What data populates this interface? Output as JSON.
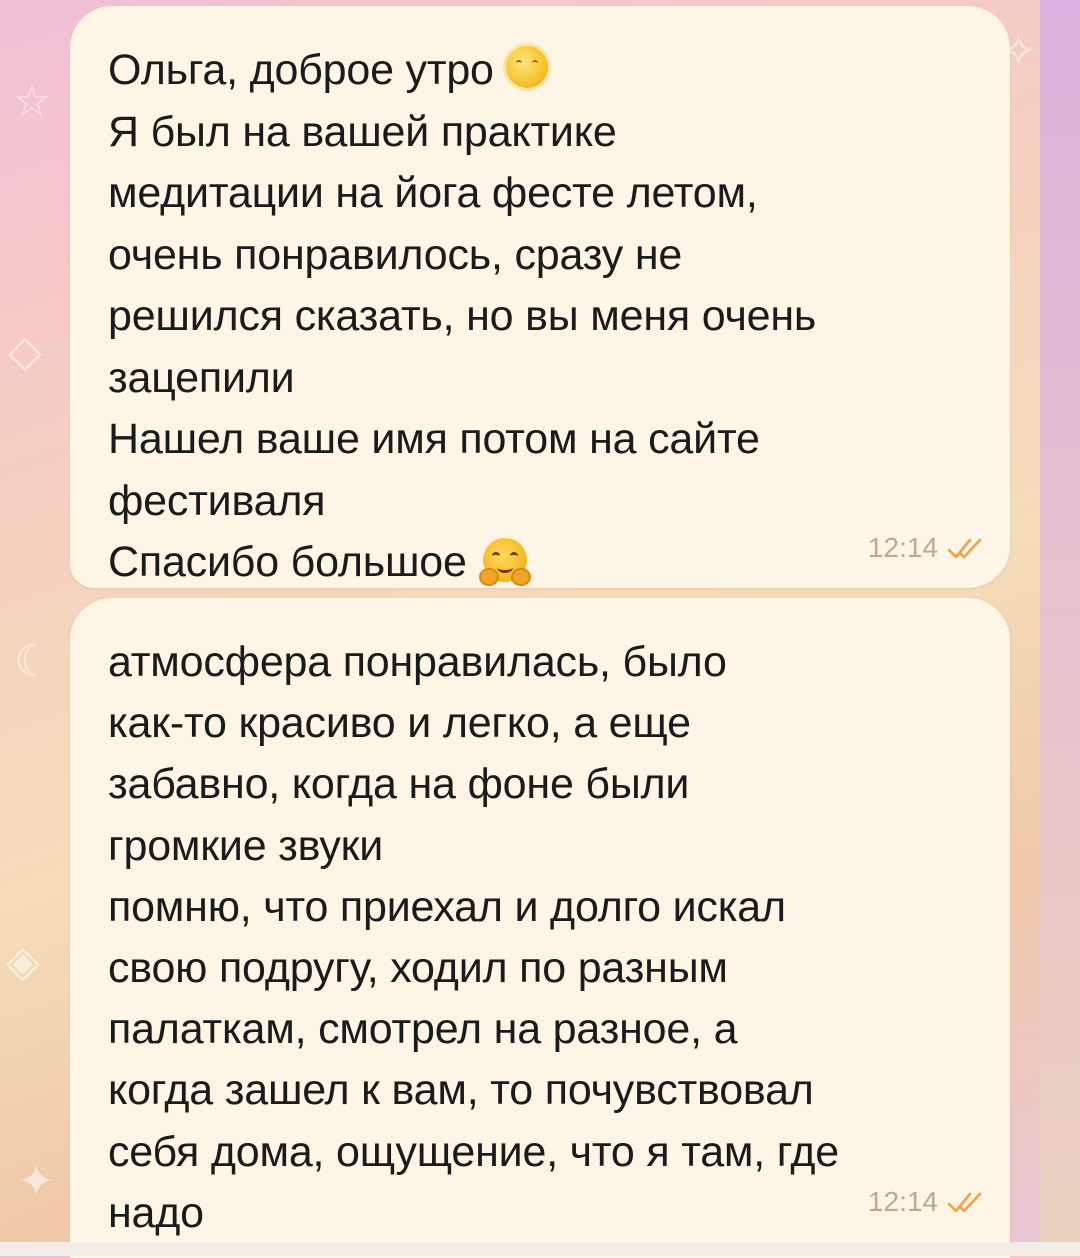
{
  "chat": {
    "messages": [
      {
        "lines": [
          "Ольга, доброе утро",
          "Я был на вашей практике",
          "медитации на йога фесте летом,",
          "очень понравилось, сразу не",
          "решился сказать, но вы меня очень",
          "зацепили",
          "Нашел ваше имя потом на сайте",
          "фестиваля",
          "Спасибо большое"
        ],
        "emoji_after_line_1": "sun-with-face-icon",
        "emoji_after_line_9": "hugging-face-icon",
        "time": "12:14",
        "status": "read"
      },
      {
        "lines": [
          "атмосфера понравилась, было",
          "как-то красиво и легко, а еще",
          "забавно, когда на фоне были",
          "громкие звуки",
          "помню, что приехал и долго искал",
          "свою подругу, ходил по разным",
          "палаткам, смотрел на разное, а",
          "когда зашел к вам, то почувствовал",
          "себя дома, ощущение, что я там, где",
          "надо"
        ],
        "time": "12:14",
        "status": "read"
      }
    ]
  },
  "colors": {
    "bubble": "#fdf5e6",
    "text": "#1b1b1b",
    "meta": "#bfa98e",
    "check_mark": "#f0a14a"
  }
}
